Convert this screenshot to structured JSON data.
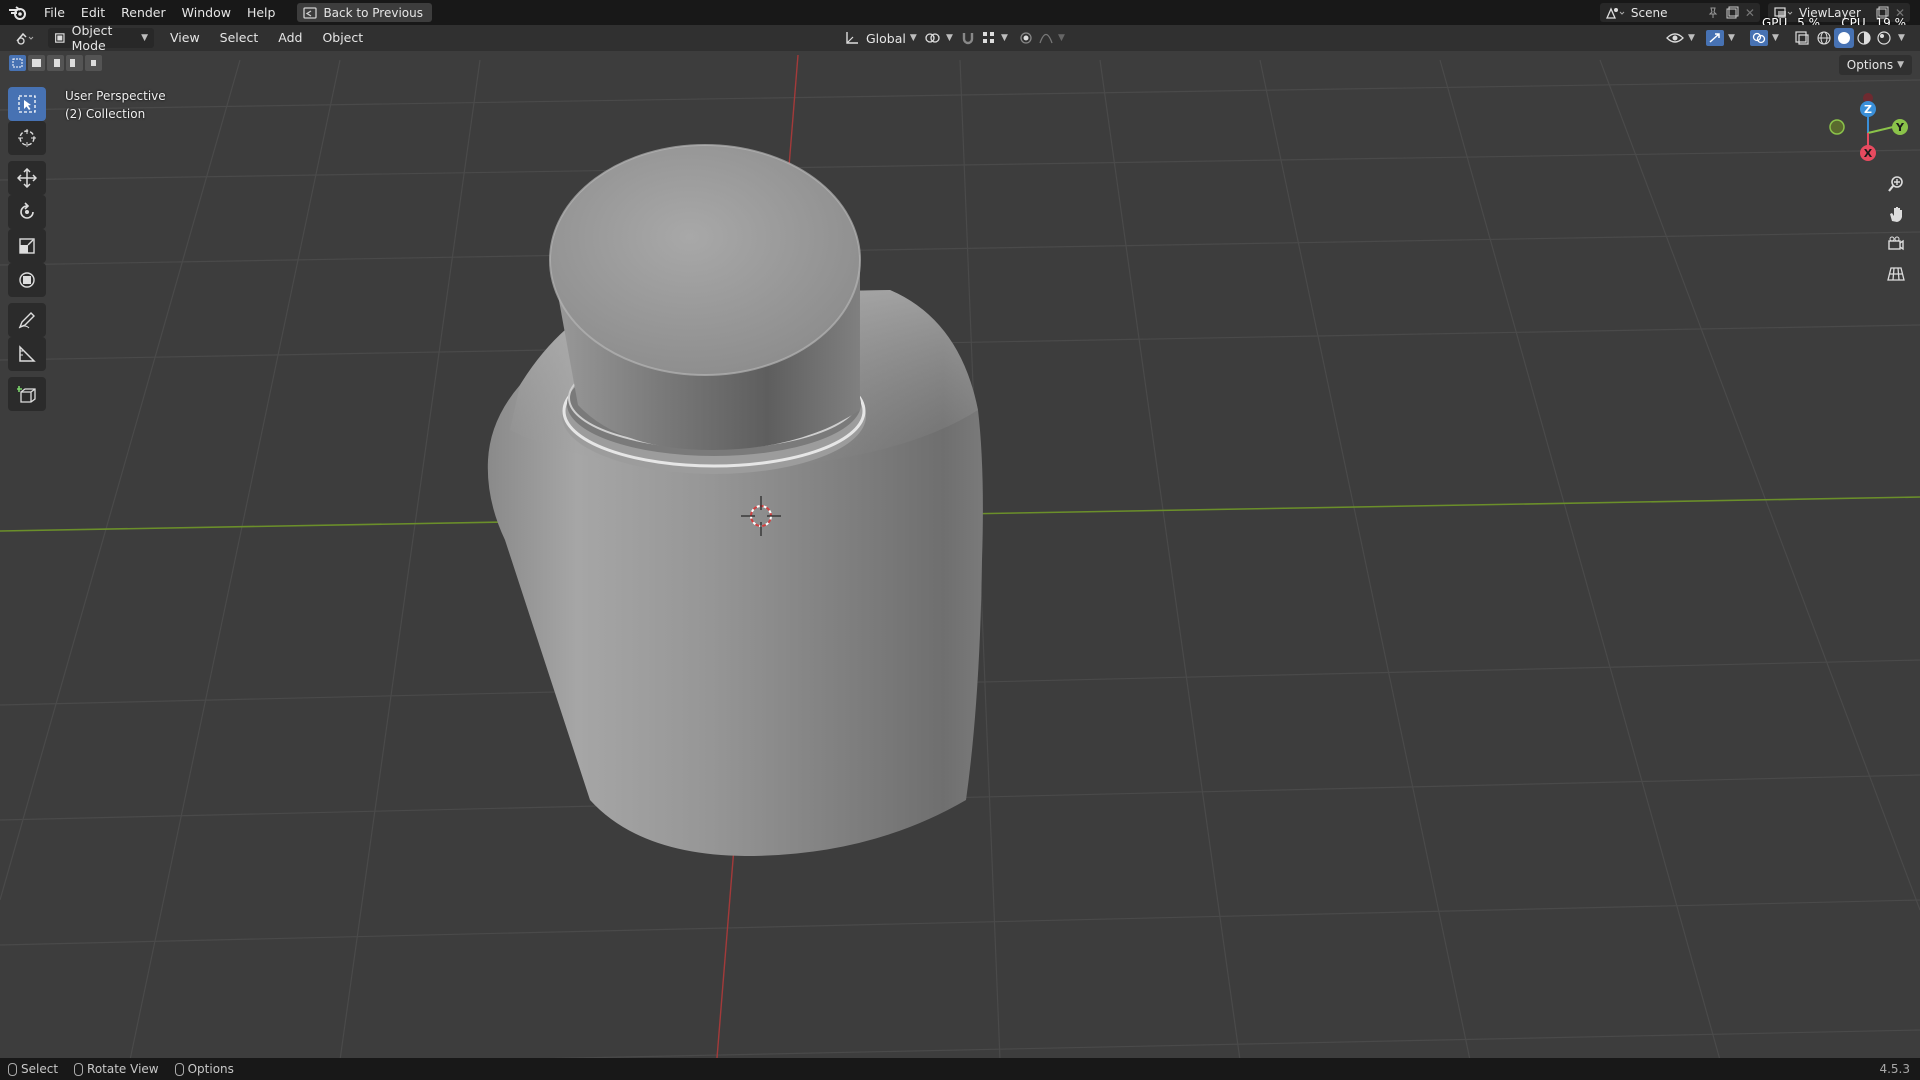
{
  "topbar": {
    "menus": [
      "File",
      "Edit",
      "Render",
      "Window",
      "Help"
    ],
    "back_label": "Back to Previous",
    "scene_name": "Scene",
    "viewlayer_name": "ViewLayer",
    "gpu_label": "GPU",
    "gpu_value": "5 %",
    "cpu_label": "CPU",
    "cpu_value": "19 %"
  },
  "header": {
    "mode_label": "Object Mode",
    "menus": [
      "View",
      "Select",
      "Add",
      "Object"
    ],
    "transform_orientation": "Global"
  },
  "viewport": {
    "perspective": "User Perspective",
    "collection": "(2) Collection",
    "options_label": "Options",
    "gizmo": {
      "z": "Z",
      "y": "Y",
      "x": "X"
    }
  },
  "statusbar": {
    "hints": [
      "Select",
      "Rotate View",
      "Options"
    ],
    "version": "4.5.3"
  },
  "colors": {
    "accent": "#4772b3",
    "background": "#3d3d3d",
    "topbar": "#181818",
    "header": "#303030",
    "x_axis": "#e84a5f",
    "y_axis": "#8bc34a",
    "z_axis": "#3a8fd8"
  }
}
